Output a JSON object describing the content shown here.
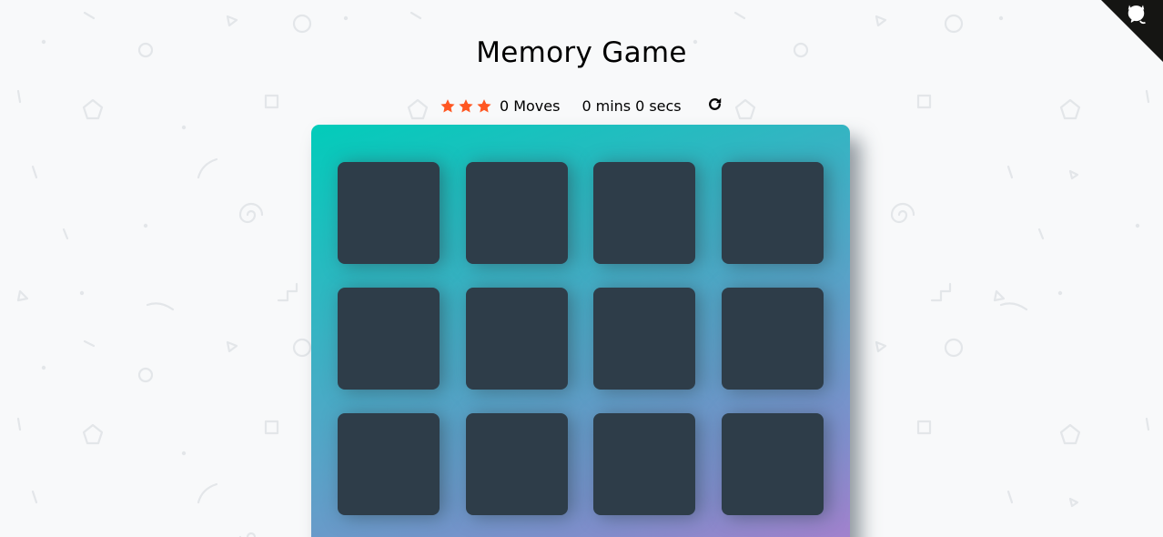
{
  "header": {
    "title": "Memory Game"
  },
  "score_panel": {
    "star_count": 3,
    "star_color": "#ff5722",
    "moves_count": "0",
    "moves_label": "Moves",
    "minutes": "0",
    "minutes_label": "mins",
    "seconds": "0",
    "seconds_label": "secs",
    "restart_icon": "rotate-right-icon"
  },
  "deck": {
    "gradient_colors": [
      "#02ccba",
      "#aa7ecd"
    ],
    "card_color": "#2e3d49",
    "cards": [
      {
        "state": "hidden"
      },
      {
        "state": "hidden"
      },
      {
        "state": "hidden"
      },
      {
        "state": "hidden"
      },
      {
        "state": "hidden"
      },
      {
        "state": "hidden"
      },
      {
        "state": "hidden"
      },
      {
        "state": "hidden"
      },
      {
        "state": "hidden"
      },
      {
        "state": "hidden"
      },
      {
        "state": "hidden"
      },
      {
        "state": "hidden"
      }
    ]
  },
  "github_corner": {
    "icon": "github-octocat-icon",
    "color": "#151513"
  }
}
